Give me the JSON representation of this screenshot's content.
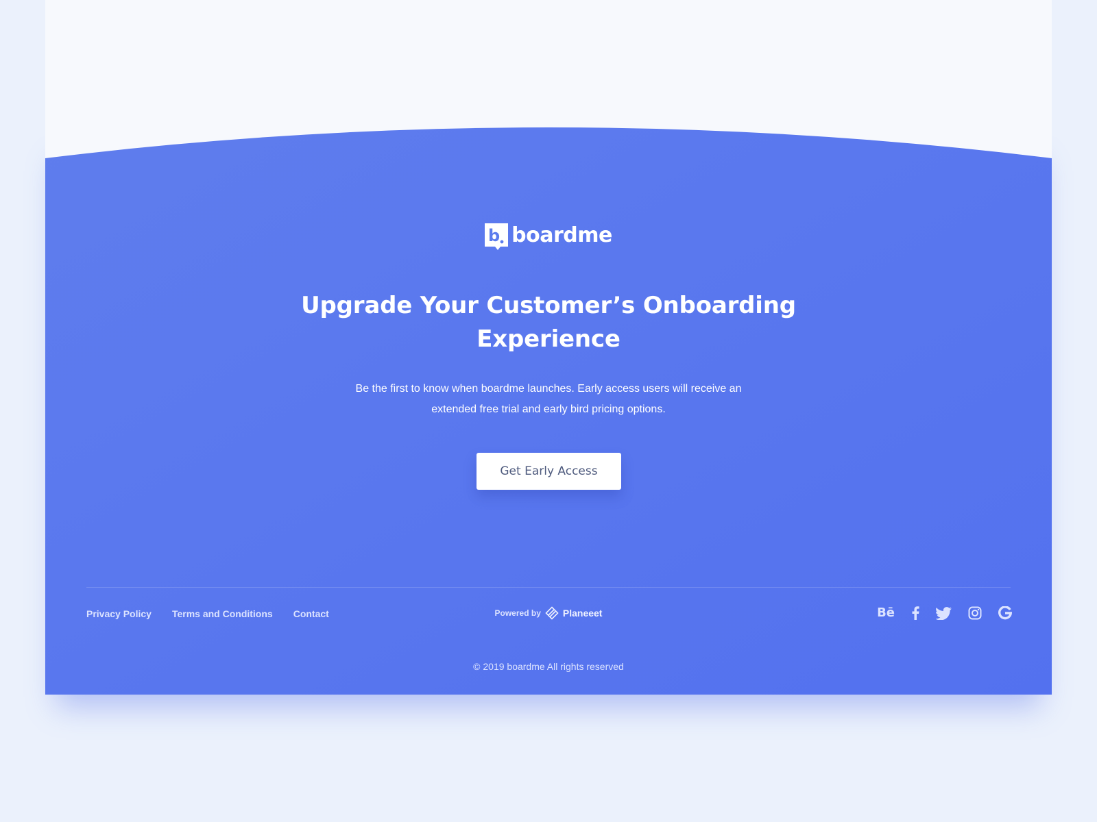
{
  "brand": {
    "name": "boardme",
    "mark_letter": "b"
  },
  "hero": {
    "title": "Upgrade Your Customer’s Onboarding Experience",
    "subtitle": "Be the first to know when boardme launches. Early access users will receive an extended free trial and early bird pricing options.",
    "cta_label": "Get Early Access"
  },
  "footer": {
    "links": [
      {
        "label": "Privacy Policy"
      },
      {
        "label": "Terms and Conditions"
      },
      {
        "label": "Contact"
      }
    ],
    "powered_by": {
      "label": "Powered by",
      "brand": "Planeeet"
    },
    "socials": [
      {
        "name": "behance-icon",
        "label": "Bē"
      },
      {
        "name": "facebook-icon"
      },
      {
        "name": "twitter-icon"
      },
      {
        "name": "instagram-icon"
      },
      {
        "name": "google-icon"
      }
    ],
    "copyright": "© 2019 boardme All rights reserved"
  },
  "colors": {
    "page_background": "#ebf1fc",
    "card_background": "#f7f9fd",
    "brand_blue": "#5b7cee",
    "button_text": "#4f5b7e",
    "footer_text": "#dce3ff"
  }
}
